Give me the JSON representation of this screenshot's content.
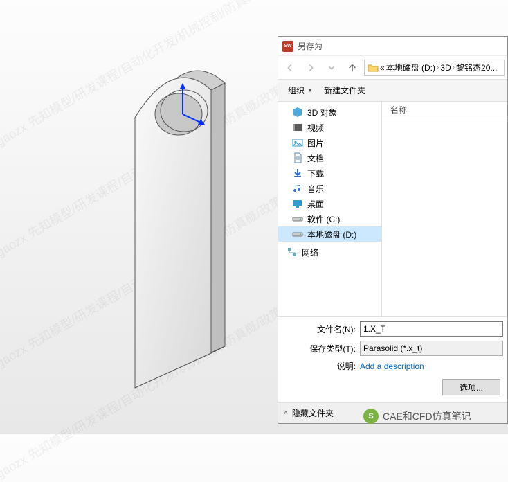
{
  "watermark_text": "gaozx 先知模型/研发课程/自动化开发/机械控制/防真概/政策及力学",
  "dialog": {
    "title": "另存为",
    "app_icon_label": "SW",
    "breadcrumb": {
      "prefix": "«",
      "parts": [
        "本地磁盘 (D:)",
        "3D",
        "黎铭杰20..."
      ]
    },
    "toolbar": {
      "organize": "组织",
      "new_folder": "新建文件夹"
    },
    "tree": [
      {
        "icon": "cube",
        "label": "3D 对象",
        "color": "#2e9bd6"
      },
      {
        "icon": "film",
        "label": "视频",
        "color": "#5a5a5a"
      },
      {
        "icon": "image",
        "label": "图片",
        "color": "#2e9bd6"
      },
      {
        "icon": "doc",
        "label": "文档",
        "color": "#5a8bb0"
      },
      {
        "icon": "download",
        "label": "下载",
        "color": "#2e6bd6"
      },
      {
        "icon": "music",
        "label": "音乐",
        "color": "#2e6bd6"
      },
      {
        "icon": "desktop",
        "label": "桌面",
        "color": "#2e9bd6"
      },
      {
        "icon": "disk",
        "label": "软件 (C:)",
        "color": "#5a5a5a"
      },
      {
        "icon": "disk",
        "label": "本地磁盘 (D:)",
        "color": "#5a5a5a",
        "selected": true
      }
    ],
    "network_label": "网络",
    "list_header": "名称",
    "filename_label": "文件名(N):",
    "filename_value": "1.X_T",
    "filetype_label": "保存类型(T):",
    "filetype_value": "Parasolid (*.x_t)",
    "desc_label": "说明:",
    "desc_link": "Add a description",
    "options_btn": "选项...",
    "hide_folders": "隐藏文件夹"
  },
  "caption": "CAE和CFD仿真笔记"
}
